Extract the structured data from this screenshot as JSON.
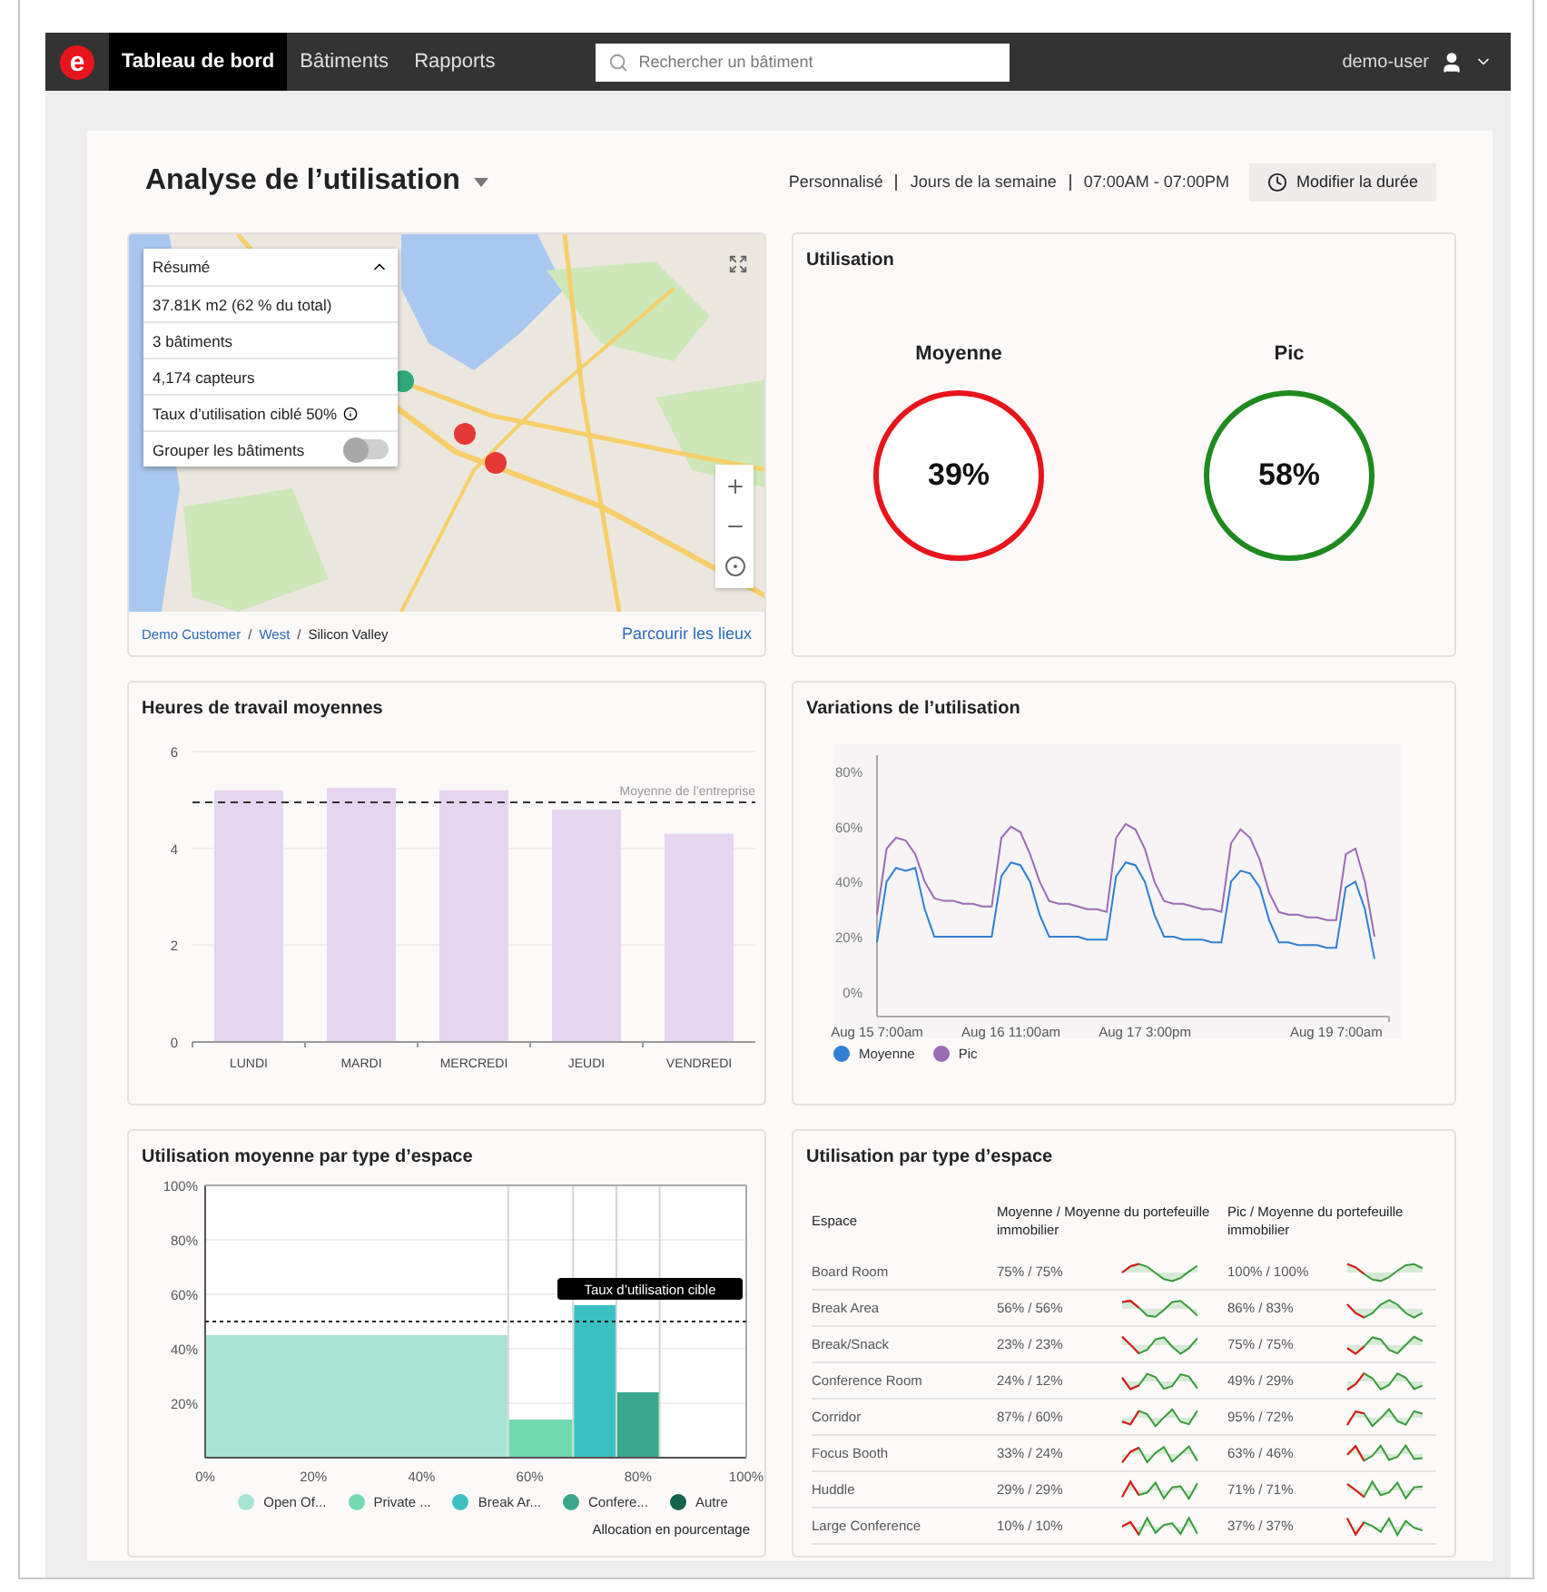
{
  "header": {
    "logo": "e",
    "nav": [
      {
        "label": "Tableau de bord",
        "selected": true
      },
      {
        "label": "Bâtiments",
        "selected": false
      },
      {
        "label": "Rapports",
        "selected": false
      }
    ],
    "search": {
      "placeholder": "Rechercher un bâtiment"
    },
    "user": "demo-user"
  },
  "page": {
    "title": "Analyse de l’utilisation",
    "filters": [
      "Personnalisé",
      "Jours de la semaine",
      "07:00AM - 07:00PM"
    ],
    "action": "Modifier la durée"
  },
  "map": {
    "summary": {
      "title": "Résumé",
      "expanded": true,
      "lines": [
        "37.81K m2 (62 % du total)",
        "3 bâtiments",
        "4,174 capteurs"
      ],
      "target": "Taux d’utilisation ciblé 50%",
      "group_label": "Grouper les bâtiments",
      "group_on": false
    },
    "markers": [
      {
        "color": "#2eaa7a"
      },
      {
        "color": "#e53935"
      },
      {
        "color": "#e53935"
      }
    ],
    "breadcrumb": [
      {
        "label": "Demo Customer",
        "current": false
      },
      {
        "label": "West",
        "current": false
      },
      {
        "label": "Silicon Valley",
        "current": true
      }
    ],
    "breadcrumb_separator": "/",
    "browse_link": "Parcourir les lieux"
  },
  "utilisation": {
    "title": "Utilisation",
    "gauges": [
      {
        "label": "Moyenne",
        "value": "39%",
        "color": "#e8141b"
      },
      {
        "label": "Pic",
        "value": "58%",
        "color": "#1e8a1e"
      }
    ]
  },
  "work_hours": {
    "chart_data": {
      "type": "bar",
      "title": "Heures de travail moyennes",
      "categories": [
        "LUNDI",
        "MARDI",
        "MERCREDI",
        "JEUDI",
        "VENDREDI"
      ],
      "series": [
        {
          "color": "#e6d5f0",
          "values": [
            5.2,
            5.25,
            5.2,
            4.8,
            4.3
          ]
        }
      ],
      "ylim": [
        0,
        6
      ],
      "yticks": [
        0,
        2,
        4,
        6
      ],
      "ref_lines": [
        {
          "axis": "y",
          "value": 4.95,
          "label": "Moyenne de l’entreprise"
        }
      ]
    }
  },
  "variations": {
    "chart_data": {
      "type": "line",
      "title": "Variations de l’utilisation",
      "categories": [
        "Aug 15 7:00am",
        null,
        null,
        null,
        null,
        null,
        null,
        null,
        null,
        null,
        null,
        null,
        null,
        null,
        "Aug 16 11:00am",
        null,
        null,
        null,
        null,
        null,
        null,
        null,
        null,
        null,
        null,
        null,
        null,
        null,
        "Aug 17 3:00pm",
        null,
        null,
        null,
        null,
        null,
        null,
        null,
        null,
        null,
        null,
        null,
        null,
        null,
        null,
        null,
        null,
        null,
        null,
        null,
        "Aug 19 7:00am",
        null,
        null,
        null,
        null
      ],
      "series": [
        {
          "name": "Moyenne",
          "color": "#2f7fd3",
          "values": [
            18,
            40,
            45,
            44,
            45,
            30,
            20,
            20,
            20,
            20,
            20,
            20,
            20,
            42,
            47,
            46,
            40,
            28,
            20,
            20,
            20,
            20,
            19,
            19,
            19,
            42,
            47,
            46,
            40,
            28,
            20,
            20,
            19,
            19,
            19,
            18,
            18,
            40,
            44,
            43,
            38,
            26,
            18,
            18,
            17,
            17,
            17,
            16,
            16,
            38,
            40,
            30,
            12
          ]
        },
        {
          "name": "Pic",
          "color": "#9b6bb5",
          "values": [
            28,
            52,
            56,
            55,
            50,
            40,
            34,
            33,
            33,
            32,
            32,
            31,
            31,
            56,
            60,
            58,
            50,
            40,
            33,
            32,
            32,
            31,
            30,
            30,
            29,
            56,
            61,
            59,
            52,
            40,
            33,
            32,
            32,
            31,
            30,
            30,
            29,
            54,
            59,
            56,
            48,
            36,
            29,
            28,
            28,
            27,
            27,
            26,
            26,
            50,
            52,
            40,
            20
          ]
        }
      ],
      "ylim": [
        -9,
        86
      ],
      "yticks": [
        {
          "value": 0,
          "label": "0%"
        },
        {
          "value": 20,
          "label": "20%"
        },
        {
          "value": 40,
          "label": "40%"
        },
        {
          "value": 60,
          "label": "60%"
        },
        {
          "value": 80,
          "label": "80%"
        }
      ]
    }
  },
  "by_space": {
    "chart_data": {
      "type": "bar",
      "title": "Utilisation moyenne par type d’espace",
      "xlabel": "Allocation en pourcentage",
      "x": [
        28,
        62,
        72,
        80,
        92
      ],
      "series": [
        {
          "name": "Open Of...",
          "color": "#a8e4d2",
          "values": [
            45,
            null,
            null,
            null,
            null
          ]
        },
        {
          "name": "Private ...",
          "color": "#72d9b1",
          "values": [
            null,
            14,
            null,
            null,
            null
          ]
        },
        {
          "name": "Break Ar...",
          "color": "#3cc1c3",
          "values": [
            null,
            null,
            56,
            null,
            null
          ]
        },
        {
          "name": "Confere...",
          "color": "#3aa68a",
          "values": [
            null,
            null,
            null,
            24,
            null
          ]
        },
        {
          "name": "Autre",
          "color": "#13634a",
          "values": [
            null,
            null,
            null,
            null,
            0
          ]
        }
      ],
      "xlim": [
        0,
        100
      ],
      "ylim": [
        0,
        100
      ],
      "xticks": [
        {
          "value": 0,
          "label": "0%"
        },
        {
          "value": 20,
          "label": "20%"
        },
        {
          "value": 40,
          "label": "40%"
        },
        {
          "value": 60,
          "label": "60%"
        },
        {
          "value": 80,
          "label": "80%"
        },
        {
          "value": 100,
          "label": "100%"
        }
      ],
      "yticks": [
        {
          "value": 20,
          "label": "20%"
        },
        {
          "value": 40,
          "label": "40%"
        },
        {
          "value": 60,
          "label": "60%"
        },
        {
          "value": 80,
          "label": "80%"
        },
        {
          "value": 100,
          "label": "100%"
        }
      ],
      "grid": true,
      "ref_lines": [
        {
          "axis": "y",
          "value": 50,
          "label": "Taux d’utilisation cible"
        }
      ]
    }
  },
  "space_table": {
    "title": "Utilisation par type d’espace",
    "columns": [
      "Espace",
      "Moyenne / Moyenne du portefeuille immobilier",
      "Pic / Moyenne du portefeuille immobilier"
    ],
    "rows": [
      {
        "space": "Board Room",
        "average": "75% / 75%",
        "peak": "100% / 100%"
      },
      {
        "space": "Break Area",
        "average": "56% / 56%",
        "peak": "86% / 83%"
      },
      {
        "space": "Break/Snack",
        "average": "23% / 23%",
        "peak": "75% / 75%"
      },
      {
        "space": "Conference Room",
        "average": "24% / 12%",
        "peak": "49% / 29%"
      },
      {
        "space": "Corridor",
        "average": "87% / 60%",
        "peak": "95% / 72%"
      },
      {
        "space": "Focus Booth",
        "average": "33% / 24%",
        "peak": "63% / 46%"
      },
      {
        "space": "Huddle",
        "average": "29% / 29%",
        "peak": "71% / 71%"
      },
      {
        "space": "Large Conference",
        "average": "10% / 10%",
        "peak": "37% / 37%"
      }
    ]
  }
}
